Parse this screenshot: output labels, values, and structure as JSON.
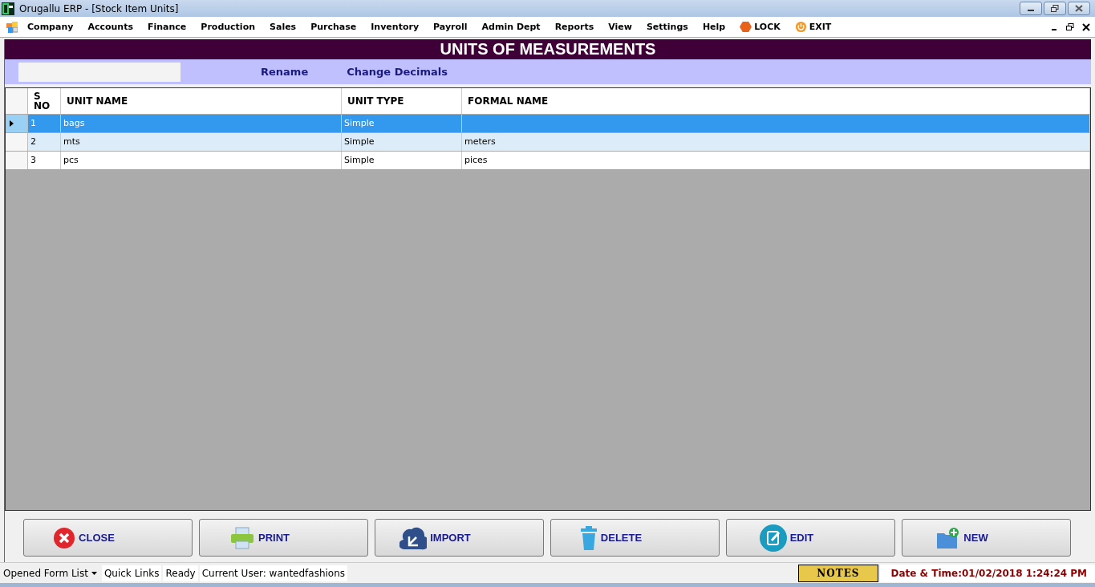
{
  "window": {
    "title": "Orugallu ERP - [Stock Item Units]"
  },
  "menu": [
    {
      "label": "Company"
    },
    {
      "label": "Accounts"
    },
    {
      "label": "Finance"
    },
    {
      "label": "Production"
    },
    {
      "label": "Sales"
    },
    {
      "label": "Purchase"
    },
    {
      "label": "Inventory"
    },
    {
      "label": "Payroll"
    },
    {
      "label": "Admin Dept"
    },
    {
      "label": "Reports"
    },
    {
      "label": "View"
    },
    {
      "label": "Settings"
    },
    {
      "label": "Help"
    }
  ],
  "menu_actions": [
    {
      "label": "LOCK",
      "kind": "lock"
    },
    {
      "label": "EXIT",
      "kind": "exit"
    }
  ],
  "form": {
    "title": "UNITS OF MEASUREMENTS",
    "toolbar": [
      "Rename",
      "Change Decimals"
    ]
  },
  "table": {
    "columns": [
      "S\nNO",
      "UNIT NAME",
      "UNIT TYPE",
      "FORMAL NAME"
    ],
    "rows": [
      {
        "cells": [
          "1",
          "bags",
          "Simple",
          ""
        ],
        "selected": true
      },
      {
        "cells": [
          "2",
          "mts",
          "Simple",
          "meters"
        ],
        "selected": false
      },
      {
        "cells": [
          "3",
          "pcs",
          "Simple",
          "pices"
        ],
        "selected": false
      }
    ]
  },
  "buttons": [
    {
      "label": "CLOSE",
      "kind": "close"
    },
    {
      "label": "PRINT",
      "kind": "print"
    },
    {
      "label": "IMPORT",
      "kind": "import"
    },
    {
      "label": "DELETE",
      "kind": "delete"
    },
    {
      "label": "EDIT",
      "kind": "edit"
    },
    {
      "label": "NEW",
      "kind": "new"
    }
  ],
  "status_bar": {
    "form_list": "Opened Form List",
    "quick_links": "Quick Links",
    "status": "Ready",
    "user": "Current User: wantedfashions",
    "notes": "NOTES",
    "datetime": "Date & Time:01/02/2018 1:24:24 PM"
  }
}
